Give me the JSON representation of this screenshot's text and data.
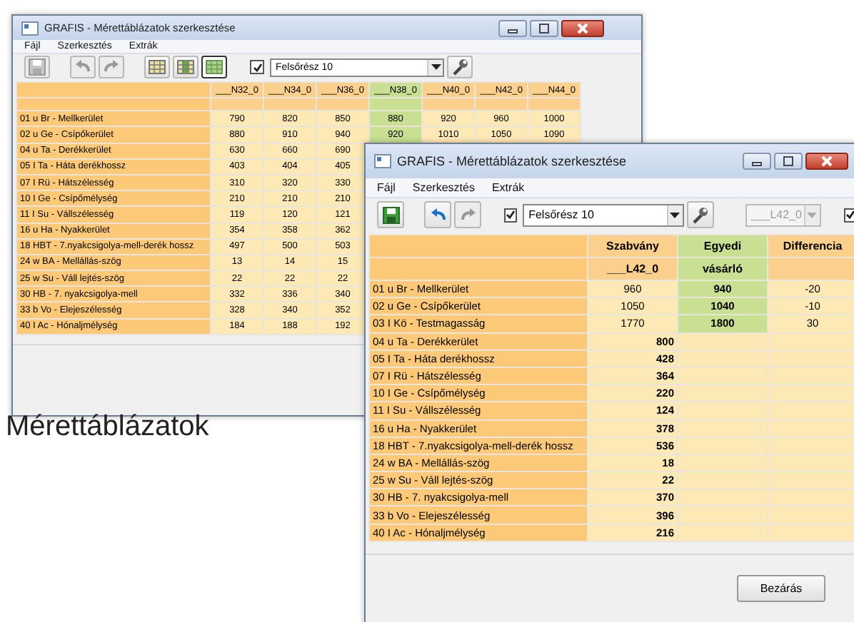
{
  "back_window": {
    "title": "GRAFIS - Mérettáblázatok szerkesztése",
    "menu": [
      "Fájl",
      "Szerkesztés",
      "Extrák"
    ],
    "toolbar": [
      {
        "kind": "save",
        "disabled": true
      },
      {
        "kind": "undo",
        "disabled": true
      },
      {
        "kind": "redo",
        "disabled": true
      },
      {
        "kind": "grid",
        "selected": false
      },
      {
        "kind": "grid-marked",
        "selected": false
      },
      {
        "kind": "grid-green",
        "selected": true
      }
    ],
    "filter": {
      "checked": true,
      "value": "Felsőrész 10"
    },
    "table": {
      "columns": [
        {
          "label": "___N32_0",
          "selected": false
        },
        {
          "label": "___N34_0",
          "selected": false
        },
        {
          "label": "___N36_0",
          "selected": false
        },
        {
          "label": "___N38_0",
          "selected": true
        },
        {
          "label": "___N40_0",
          "selected": false
        },
        {
          "label": "___N42_0",
          "selected": false
        },
        {
          "label": "___N44_0",
          "selected": false
        }
      ],
      "rows": [
        {
          "label": "01 u Br - Mellkerület",
          "values": [
            "790",
            "820",
            "850",
            "880",
            "920",
            "960",
            "1000"
          ]
        },
        {
          "label": "02 u Ge - Csípőkerület",
          "values": [
            "880",
            "910",
            "940",
            "920",
            "1010",
            "1050",
            "1090"
          ]
        },
        {
          "label": "04 u Ta - Derékkerület",
          "values": [
            "630",
            "660",
            "690"
          ]
        },
        {
          "label": "05 I Ta - Háta derékhossz",
          "values": [
            "403",
            "404",
            "405"
          ]
        },
        {
          "label": "07 I Rü - Hátszélesség",
          "values": [
            "310",
            "320",
            "330"
          ]
        },
        {
          "label": "10 I Ge - Csípőmélység",
          "values": [
            "210",
            "210",
            "210"
          ]
        },
        {
          "label": "11 I Su - Vállszélesség",
          "values": [
            "119",
            "120",
            "121"
          ]
        },
        {
          "label": "16 u Ha - Nyakkerület",
          "values": [
            "354",
            "358",
            "362"
          ]
        },
        {
          "label": "18 HBT - 7.nyakcsigolya-mell-derék hossz",
          "values": [
            "497",
            "500",
            "503"
          ]
        },
        {
          "label": "24 w BA - Mellállás-szög",
          "values": [
            "13",
            "14",
            "15"
          ]
        },
        {
          "label": "25 w Su - Váll lejtés-szög",
          "values": [
            "22",
            "22",
            "22"
          ]
        },
        {
          "label": "30 HB - 7. nyakcsigolya-mell",
          "values": [
            "332",
            "336",
            "340"
          ]
        },
        {
          "label": "33 b Vo - Elejeszélesség",
          "values": [
            "328",
            "340",
            "352"
          ]
        },
        {
          "label": "40 I Ac - Hónaljmélység",
          "values": [
            "184",
            "188",
            "192"
          ]
        }
      ]
    }
  },
  "caption": "Mérettáblázatok",
  "front_window": {
    "title": "GRAFIS - Mérettáblázatok szerkesztése",
    "menu": [
      "Fájl",
      "Szerkesztés",
      "Extrák"
    ],
    "toolbar": [
      {
        "kind": "save",
        "disabled": false
      },
      {
        "kind": "undo",
        "disabled": false
      },
      {
        "kind": "redo",
        "disabled": true
      }
    ],
    "filter": {
      "checked": true,
      "value": "Felsőrész 10"
    },
    "size_select": {
      "value": "___L42_0",
      "disabled": true
    },
    "extra_checkbox": {
      "checked": true
    },
    "table": {
      "columns": [
        {
          "label": "Szabvány",
          "subtitle": "___L42_0"
        },
        {
          "label": "Egyedi",
          "subtitle": "vásárló"
        },
        {
          "label": "Differencia"
        }
      ],
      "rows": [
        {
          "label": "01 u Br - Mellkerület",
          "kind": "custom",
          "standard": "960",
          "custom": "940",
          "difference": "-20"
        },
        {
          "label": "02 u Ge - Csípőkerület",
          "kind": "custom",
          "standard": "1050",
          "custom": "1040",
          "difference": "-10"
        },
        {
          "label": "03 I Kö - Testmagasság",
          "kind": "custom",
          "standard": "1770",
          "custom": "1800",
          "difference": "30"
        },
        {
          "label": "04 u Ta - Derékkerület",
          "kind": "standard",
          "standard": "800"
        },
        {
          "label": "05 I Ta - Háta derékhossz",
          "kind": "standard",
          "standard": "428"
        },
        {
          "label": "07 I Rü - Hátszélesség",
          "kind": "standard",
          "standard": "364"
        },
        {
          "label": "10 I Ge - Csípőmélység",
          "kind": "standard",
          "standard": "220"
        },
        {
          "label": "11 I Su - Vállszélesség",
          "kind": "standard",
          "standard": "124"
        },
        {
          "label": "16 u Ha - Nyakkerület",
          "kind": "standard",
          "standard": "378"
        },
        {
          "label": "18 HBT - 7.nyakcsigolya-mell-derék hossz",
          "kind": "standard",
          "standard": "536"
        },
        {
          "label": "24 w BA - Mellállás-szög",
          "kind": "standard",
          "standard": "18"
        },
        {
          "label": "25 w Su - Váll lejtés-szög",
          "kind": "standard",
          "standard": "22"
        },
        {
          "label": "30 HB - 7. nyakcsigolya-mell",
          "kind": "standard",
          "standard": "370"
        },
        {
          "label": "33 b Vo - Elejeszélesség",
          "kind": "standard",
          "standard": "396"
        },
        {
          "label": "40 I Ac - Hónaljmélység",
          "kind": "standard",
          "standard": "216"
        }
      ]
    },
    "buttons": [
      "Bezárás"
    ]
  }
}
